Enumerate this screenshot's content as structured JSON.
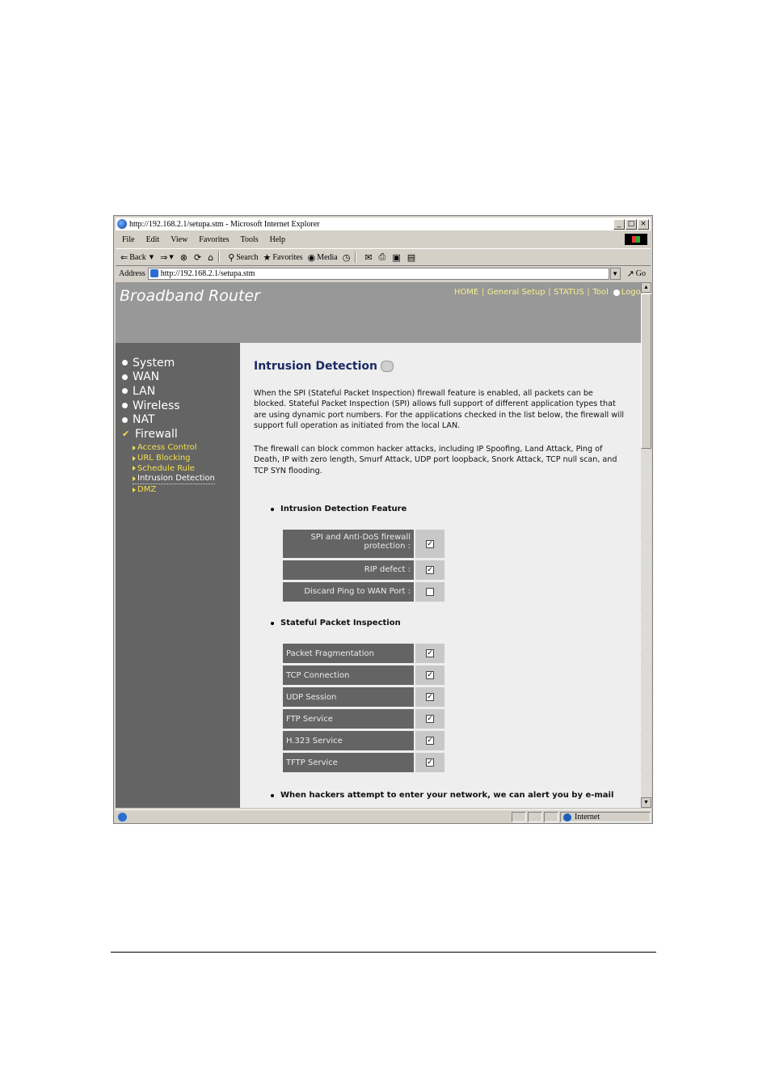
{
  "window": {
    "title": "http://192.168.2.1/setupa.stm - Microsoft Internet Explorer",
    "controls": [
      "_",
      "□",
      "×"
    ]
  },
  "menubar": [
    "File",
    "Edit",
    "View",
    "Favorites",
    "Tools",
    "Help"
  ],
  "toolbar": {
    "back": "Back",
    "search": "Search",
    "favorites": "Favorites",
    "media": "Media"
  },
  "address": {
    "label": "Address",
    "value": "http://192.168.2.1/setupa.stm",
    "go": "Go"
  },
  "header": {
    "brand": "Broadband Router",
    "nav": [
      "HOME",
      "General Setup",
      "STATUS",
      "Tool",
      "Logout"
    ]
  },
  "sidebar": {
    "items": [
      "System",
      "WAN",
      "LAN",
      "Wireless",
      "NAT",
      "Firewall"
    ],
    "sub_items": [
      "Access Control",
      "URL Blocking",
      "Schedule Rule",
      "Intrusion Detection",
      "DMZ"
    ]
  },
  "content": {
    "title": "Intrusion Detection",
    "paragraph1": "When the SPI (Stateful Packet Inspection) firewall feature is enabled, all packets can be blocked.  Stateful Packet Inspection (SPI) allows full support of different application types that are using dynamic port numbers.  For the applications checked in the list below, the firewall will support full operation as initiated from the local LAN.",
    "paragraph2": "The firewall can block common hacker attacks, including IP Spoofing, Land Attack, Ping of Death, IP with zero length, Smurf Attack, UDP port loopback, Snork Attack, TCP null scan, and TCP SYN flooding.",
    "section1": "Intrusion Detection Feature",
    "features": [
      {
        "label": "SPI and Anti-DoS firewall protection :",
        "checked": true
      },
      {
        "label": "RIP defect :",
        "checked": true
      },
      {
        "label": "Discard Ping to WAN Port :",
        "checked": false
      }
    ],
    "section2": "Stateful Packet Inspection",
    "spi": [
      {
        "label": "Packet Fragmentation",
        "checked": true
      },
      {
        "label": "TCP Connection",
        "checked": true
      },
      {
        "label": "UDP Session",
        "checked": true
      },
      {
        "label": "FTP Service",
        "checked": true
      },
      {
        "label": "H.323 Service",
        "checked": true
      },
      {
        "label": "TFTP Service",
        "checked": true
      }
    ],
    "section3": "When hackers attempt to enter your network, we can alert you by e-mail"
  },
  "status": {
    "zone": "Internet"
  }
}
